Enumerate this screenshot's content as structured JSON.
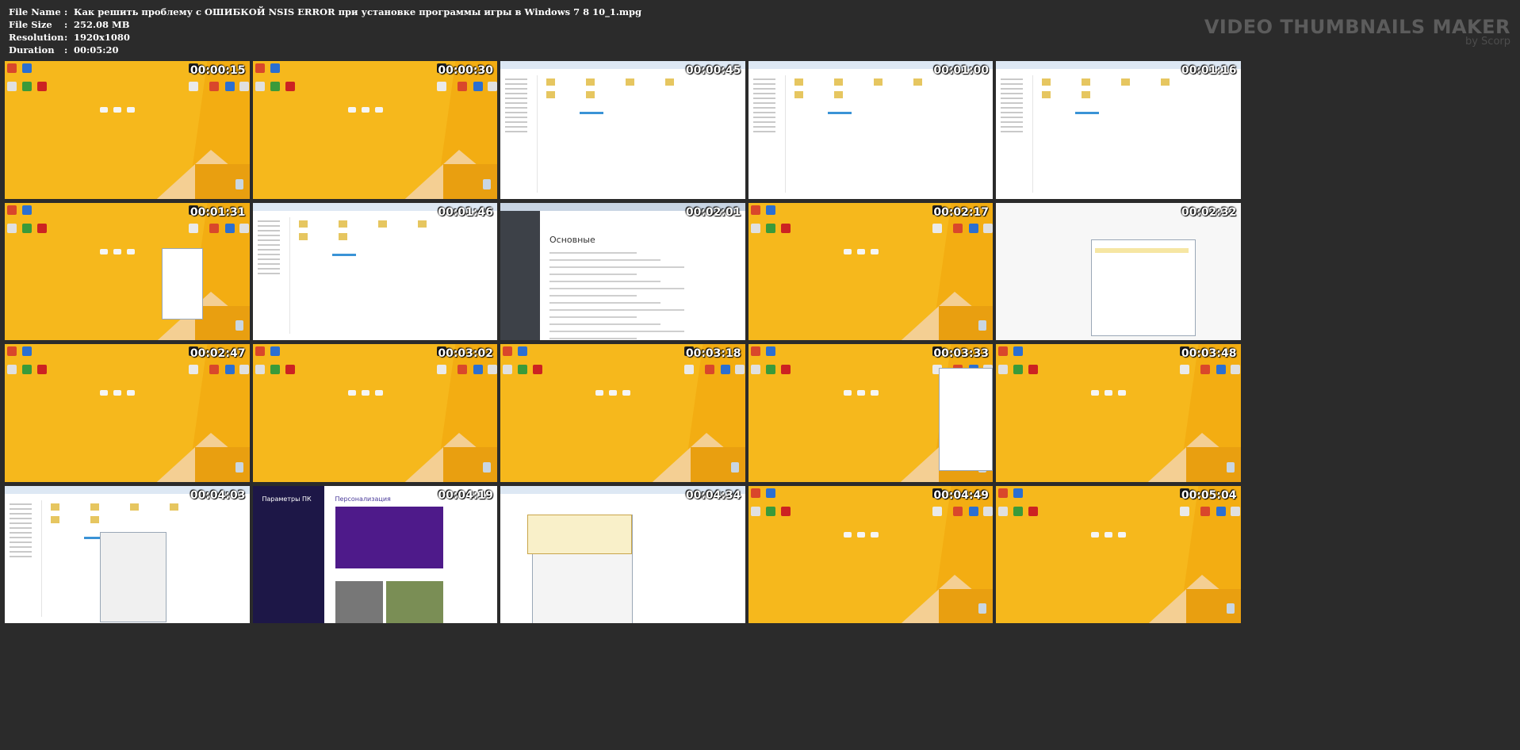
{
  "header": {
    "file_name_label": "File Name",
    "file_name": "Как решить проблему с ОШИБКОЙ NSIS ERROR при установке программы игры в Windows 7 8 10_1.mpg",
    "file_size_label": "File Size",
    "file_size": "252.08 MB",
    "resolution_label": "Resolution",
    "resolution": "1920x1080",
    "duration_label": "Duration",
    "duration": "00:05:20",
    "separator": ":"
  },
  "brand": {
    "title": "VIDEO THUMBNAILS MAKER",
    "subtitle": "by Scorp"
  },
  "thumbnails": [
    {
      "time": "00:00:15",
      "scene": "desktop"
    },
    {
      "time": "00:00:30",
      "scene": "desktop"
    },
    {
      "time": "00:00:45",
      "scene": "explorer"
    },
    {
      "time": "00:01:00",
      "scene": "explorer"
    },
    {
      "time": "00:01:16",
      "scene": "explorer"
    },
    {
      "time": "00:01:31",
      "scene": "desktop-menu"
    },
    {
      "time": "00:01:46",
      "scene": "explorer"
    },
    {
      "time": "00:02:01",
      "scene": "browser-settings"
    },
    {
      "time": "00:02:17",
      "scene": "desktop"
    },
    {
      "time": "00:02:32",
      "scene": "dialog"
    },
    {
      "time": "00:02:47",
      "scene": "desktop"
    },
    {
      "time": "00:03:02",
      "scene": "desktop"
    },
    {
      "time": "00:03:18",
      "scene": "desktop"
    },
    {
      "time": "00:03:33",
      "scene": "desktop-notepad"
    },
    {
      "time": "00:03:48",
      "scene": "desktop"
    },
    {
      "time": "00:04:03",
      "scene": "explorer-props"
    },
    {
      "time": "00:04:19",
      "scene": "pc-settings"
    },
    {
      "time": "00:04:34",
      "scene": "control-panel"
    },
    {
      "time": "00:04:49",
      "scene": "desktop"
    },
    {
      "time": "00:05:04",
      "scene": "desktop"
    }
  ],
  "scene_text": {
    "browser_heading": "Основные",
    "pc_settings_title": "Параметры ПК",
    "pc_settings_heading": "Персонализация"
  },
  "colors": {
    "background": "#2b2b2b",
    "desktop_orange": "#f3ad12",
    "wedge_beige": "#f4cf93",
    "explorer_white": "#ffffff",
    "pc_settings_nav": "#1d1747"
  }
}
